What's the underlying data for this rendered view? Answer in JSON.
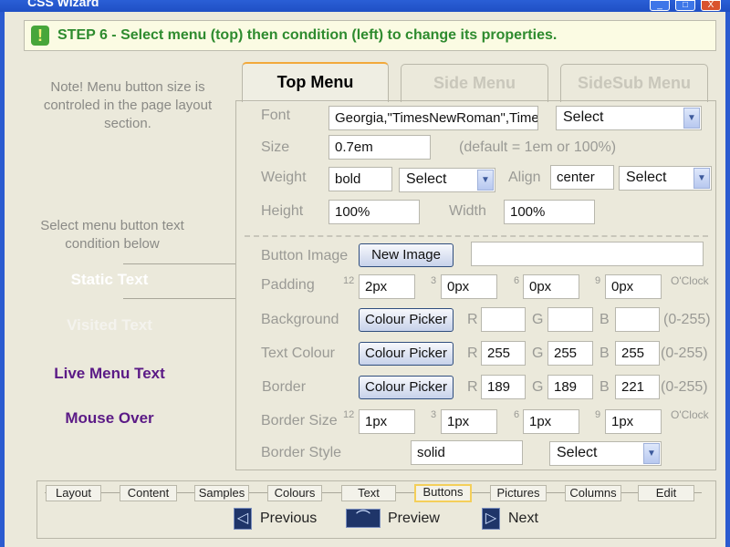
{
  "window": {
    "title": "CSS Wizard",
    "minimize": "_",
    "maximize": "□",
    "close": "X"
  },
  "banner": {
    "icon": "!",
    "text": "STEP 6 - Select menu (top) then condition (left) to change its properties."
  },
  "left": {
    "note": "Note! Menu button size is controled in the page layout section.",
    "hint": "Select menu button text condition below",
    "conditions": [
      {
        "label": "Static Text",
        "color": "#ffffff"
      },
      {
        "label": "Visited Text",
        "color": "#f4f3ee"
      },
      {
        "label": "Live Menu Text",
        "color": "#5b1a86"
      },
      {
        "label": "Mouse Over",
        "color": "#5b1a86"
      }
    ]
  },
  "tabs": [
    {
      "label": "Top Menu",
      "active": true
    },
    {
      "label": "Side Menu"
    },
    {
      "label": "SideSub Menu"
    }
  ],
  "form": {
    "font": {
      "label": "Font",
      "value": "Georgia,\"TimesNewRoman\",Times",
      "select": "Select"
    },
    "size": {
      "label": "Size",
      "value": "0.7em",
      "hint": "(default = 1em or 100%)"
    },
    "weight": {
      "label": "Weight",
      "value": "bold",
      "select": "Select"
    },
    "align": {
      "label": "Align",
      "value": "center",
      "select": "Select"
    },
    "height": {
      "label": "Height",
      "value": "100%"
    },
    "width": {
      "label": "Width",
      "value": "100%"
    },
    "button_image": {
      "label": "Button Image",
      "button": "New Image",
      "value": ""
    },
    "clock": {
      "p12": "12",
      "p3": "3",
      "p6": "6",
      "p9": "9",
      "oclock": "O'Clock"
    },
    "padding": {
      "label": "Padding",
      "values": [
        "2px",
        "0px",
        "0px",
        "0px"
      ]
    },
    "rgb": {
      "r": "R",
      "g": "G",
      "b": "B",
      "range": "(0-255)",
      "picker": "Colour Picker"
    },
    "background": {
      "label": "Background",
      "values": [
        "",
        "",
        ""
      ]
    },
    "text_colour": {
      "label": "Text Colour",
      "values": [
        "255",
        "255",
        "255"
      ]
    },
    "border": {
      "label": "Border",
      "values": [
        "189",
        "189",
        "221"
      ]
    },
    "border_size": {
      "label": "Border Size",
      "values": [
        "1px",
        "1px",
        "1px",
        "1px"
      ]
    },
    "border_style": {
      "label": "Border Style",
      "value": "solid",
      "select": "Select"
    }
  },
  "nav": {
    "steps": [
      "Layout",
      "Content",
      "Samples",
      "Colours",
      "Text",
      "Buttons",
      "Pictures",
      "Columns",
      "Edit"
    ],
    "active_step": "Buttons",
    "previous": "Previous",
    "preview": "Preview",
    "next": "Next"
  }
}
